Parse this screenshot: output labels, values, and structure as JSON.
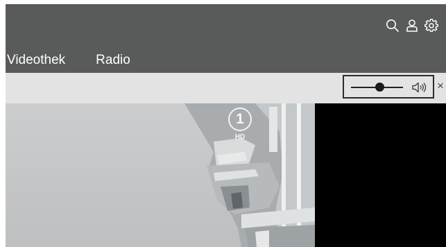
{
  "header": {
    "nav": [
      {
        "label": "Videothek"
      },
      {
        "label": "Radio"
      }
    ],
    "icons": [
      "search-icon",
      "user-icon",
      "settings-icon"
    ]
  },
  "player": {
    "volume_level_fraction": 0.55,
    "channel_logo": {
      "number": "1",
      "badge": "HD"
    },
    "close_symbol": "×"
  },
  "colors": {
    "header_bg": "#595a5a",
    "toolbar_bg": "#e3e3e3",
    "video_side": "#000000"
  }
}
